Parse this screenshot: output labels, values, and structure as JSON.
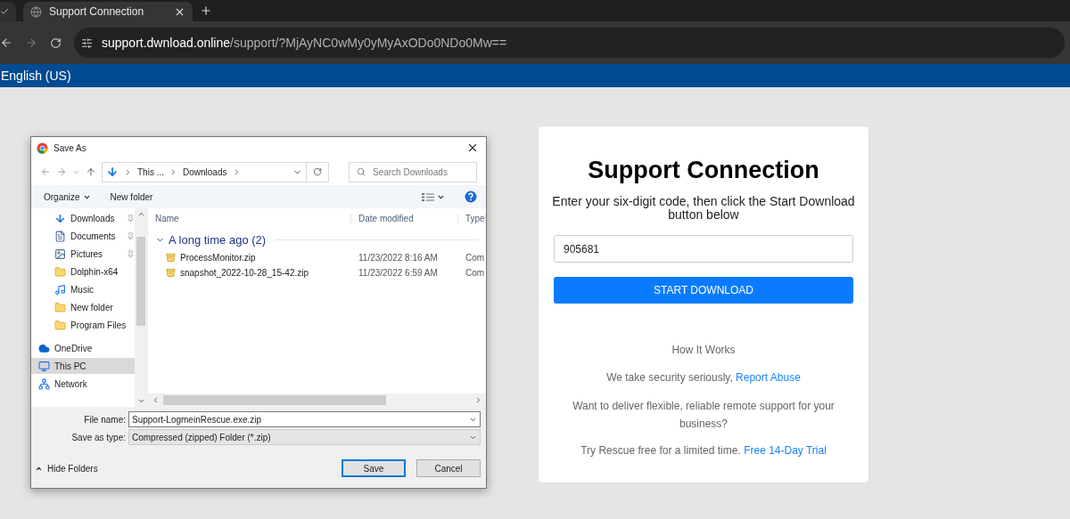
{
  "browser": {
    "tab": {
      "title": "Support Connection",
      "selected": true
    },
    "url": {
      "host": "support.dwnload.online",
      "path": "/support/?MjAyNC0wMy0yMyAxODo0NDo0Mw=="
    }
  },
  "banner": {
    "language": "English (US)"
  },
  "dialog": {
    "title": "Save As",
    "breadcrumb": [
      "This ...",
      "Downloads"
    ],
    "search": {
      "placeholder": "Search Downloads"
    },
    "toolbar": [
      "Organize",
      "New folder"
    ],
    "nav": [
      {
        "label": "Downloads",
        "kind": "download",
        "pinned": true,
        "selected": false
      },
      {
        "label": "Documents",
        "kind": "document",
        "pinned": true,
        "selected": false
      },
      {
        "label": "Pictures",
        "kind": "pictures",
        "pinned": true,
        "selected": false
      },
      {
        "label": "Dolphin-x64",
        "kind": "folder",
        "pinned": false,
        "selected": false
      },
      {
        "label": "Music",
        "kind": "music",
        "pinned": false,
        "selected": false
      },
      {
        "label": "New folder",
        "kind": "folder",
        "pinned": false,
        "selected": false
      },
      {
        "label": "Program Files",
        "kind": "folder",
        "pinned": false,
        "selected": false
      },
      {
        "label": "OneDrive",
        "kind": "cloud",
        "pinned": false,
        "selected": false
      },
      {
        "label": "This PC",
        "kind": "pc",
        "pinned": false,
        "selected": true
      },
      {
        "label": "Network",
        "kind": "network",
        "pinned": false,
        "selected": false
      }
    ],
    "columns": [
      "Name",
      "Date modified",
      "Type"
    ],
    "group": {
      "label": "A long time ago (2)",
      "expanded": true
    },
    "files": [
      {
        "name": "ProcessMonitor.zip",
        "date": "11/23/2022 8:16 AM",
        "type": "Com"
      },
      {
        "name": "snapshot_2022-10-28_15-42.zip",
        "date": "11/23/2022 6:59 AM",
        "type": "Com"
      }
    ],
    "file_name": {
      "label": "File name:",
      "value": "Support-LogmeinRescue.exe.zip"
    },
    "save_type": {
      "label": "Save as type:",
      "value": "Compressed (zipped) Folder (*.zip)"
    },
    "hide_folders": "Hide Folders",
    "buttons": [
      "Save",
      "Cancel"
    ]
  },
  "card": {
    "title": "Support Connection",
    "instructions": "Enter your six-digit code, then click the Start Download button below",
    "code": "905681",
    "button": "START DOWNLOAD",
    "how": "How It Works",
    "security": {
      "text": "We take security seriously,",
      "link": "Report Abuse"
    },
    "pitch": "Want to deliver flexible, reliable remote support for your business?",
    "trial": {
      "text": "Try Rescue free for a limited time.",
      "link": "Free 14-Day Trial"
    }
  }
}
